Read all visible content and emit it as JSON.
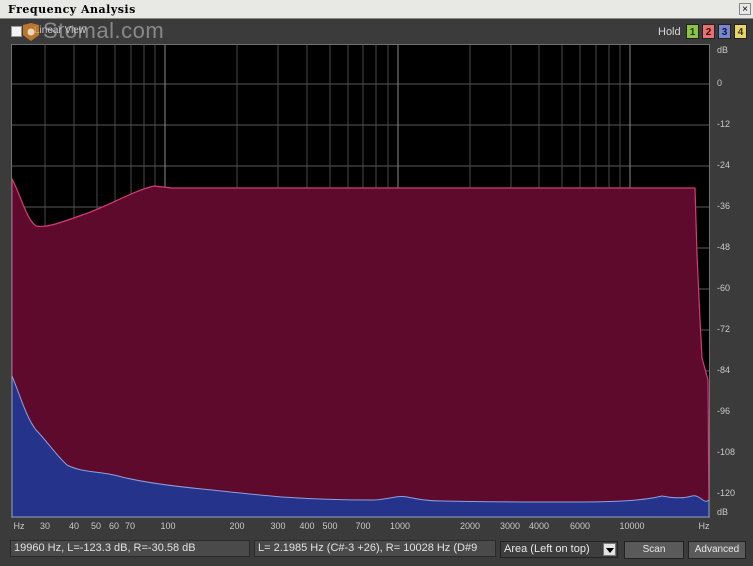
{
  "window": {
    "title": "Frequency Analysis",
    "close_label": "×"
  },
  "toolbar": {
    "linear_view_label": "Linear View",
    "watermark": "Stomal.com",
    "hold_label": "Hold",
    "hold_buttons": [
      {
        "label": "1",
        "color": "#8bc34a"
      },
      {
        "label": "2",
        "color": "#e57373"
      },
      {
        "label": "3",
        "color": "#7986cb"
      },
      {
        "label": "4",
        "color": "#e6d66a"
      }
    ]
  },
  "plot": {
    "db_unit": "dB",
    "db_ticks": [
      "0",
      "-12",
      "-24",
      "-36",
      "-48",
      "-60",
      "-72",
      "-84",
      "-96",
      "-108",
      "-120"
    ],
    "x_unit": "Hz",
    "x_ticks": [
      "30",
      "40",
      "50",
      "60",
      "70",
      "100",
      "200",
      "300",
      "400",
      "500",
      "700",
      "1000",
      "2000",
      "3000",
      "4000",
      "6000",
      "10000"
    ],
    "colors": {
      "left_channel": "#26338a",
      "right_channel": "#5e0a2c",
      "right_edge": "#d23c76",
      "left_edge": "#8aa0e0"
    }
  },
  "status": {
    "cursor_info": "19960 Hz, L=-123.3 dB, R=-30.58 dB",
    "range_info": "L= 2.1985 Hz (C#-3 +26), R=  10028 Hz (D#9",
    "view_mode": "Area (Left on top)",
    "scan_label": "Scan",
    "advanced_label": "Advanced"
  }
}
